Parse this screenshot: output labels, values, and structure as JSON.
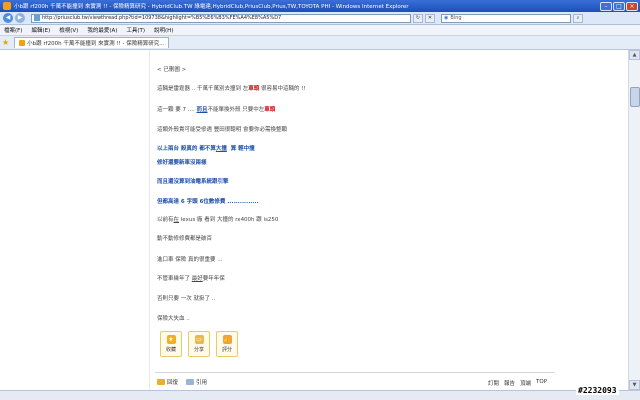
{
  "window": {
    "title": "小b跟 rf200h 千萬不能撞到 來實測 !! - 保險精算研究 - HybridClub.TW 綠電達,HybridClub,PriusClub,Prius,TW,TOYOTA PHI - Windows Internet Explorer"
  },
  "address": {
    "url": "http://priusclub.tw/viewthread.php?tid=109738&highlight=%B5%E6%B3%FE%A4%E8%A5%D7"
  },
  "search": {
    "placeholder": "Bing"
  },
  "menu": {
    "items": [
      "檔案(F)",
      "編輯(E)",
      "檢視(V)",
      "我的最愛(A)",
      "工具(T)",
      "說明(H)"
    ]
  },
  "tab": {
    "label": "小b跟 rf200h 千萬不能撞到 來實測 !! - 保險精算研究..."
  },
  "post": {
    "refresh_note": "< 已刪圖 >",
    "line1": {
      "a": "這輛是雷霆器 .. 千萬千萬別去撞到 左",
      "b": "車頭",
      "c": "很容易中這輛的 !!"
    },
    "line2": {
      "a": "這一顆 要 7 .... ",
      "b": "而且",
      "c": "不能單換外殼 只要中左",
      "d": "車頭"
    },
    "line3": "這類外殼貴可能受慘遇  豐田很聰明  會要你必需換整顆",
    "line4": {
      "a": "以上兩台 殺真的  都不算",
      "b": "大撞",
      "c": "算 輕中撞"
    },
    "line5": "修好還要新車沒兩樣",
    "line6": "而且還沒算到油電系統跟引擎",
    "line7": "但都高達 6 字頭 6位數修費 ...............",
    "line8": {
      "a": "以前有",
      "b": "在",
      "c": " lexus 廠 看到  大撞的 rx400h 跟 is250"
    },
    "line9": "動不動修修費都是破百",
    "line10": "進口車 保險 真的很重要 ...",
    "line11": {
      "a": "不管車幾年了   ",
      "b": "最好",
      "c": "要年年保"
    },
    "line12": "否則只要  一次  就掛了 ..",
    "line13": "保險大失血 .."
  },
  "actions": {
    "favorite": "收藏",
    "share": "分享",
    "rate": "評分"
  },
  "footer": {
    "reply": "回復",
    "quote": "引用",
    "links": [
      "訂閱",
      "報告",
      "頂端",
      "TOP"
    ]
  },
  "watermark": "#2232093"
}
